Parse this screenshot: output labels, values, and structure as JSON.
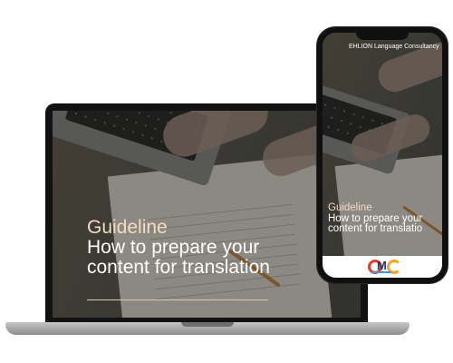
{
  "laptop": {
    "title_line1": "Guideline",
    "title_line2": "How to prepare your",
    "title_line3": "content for translation"
  },
  "phone": {
    "header": "EHLION Language Consultancy",
    "title_line1": "Guideline",
    "title_line2": "How to prepare your",
    "title_line3": "content for translatio"
  },
  "logo": {
    "name": "OMC",
    "colors": {
      "o": "#e63b2e",
      "m": "#27346d",
      "c": "#f3a524",
      "tag": "#3c9bd6"
    }
  },
  "colors": {
    "title_accent": "#f2dcc2",
    "title_main": "#ffffff",
    "device_frame": "#121212",
    "laptop_base": "#a8a8a8"
  }
}
